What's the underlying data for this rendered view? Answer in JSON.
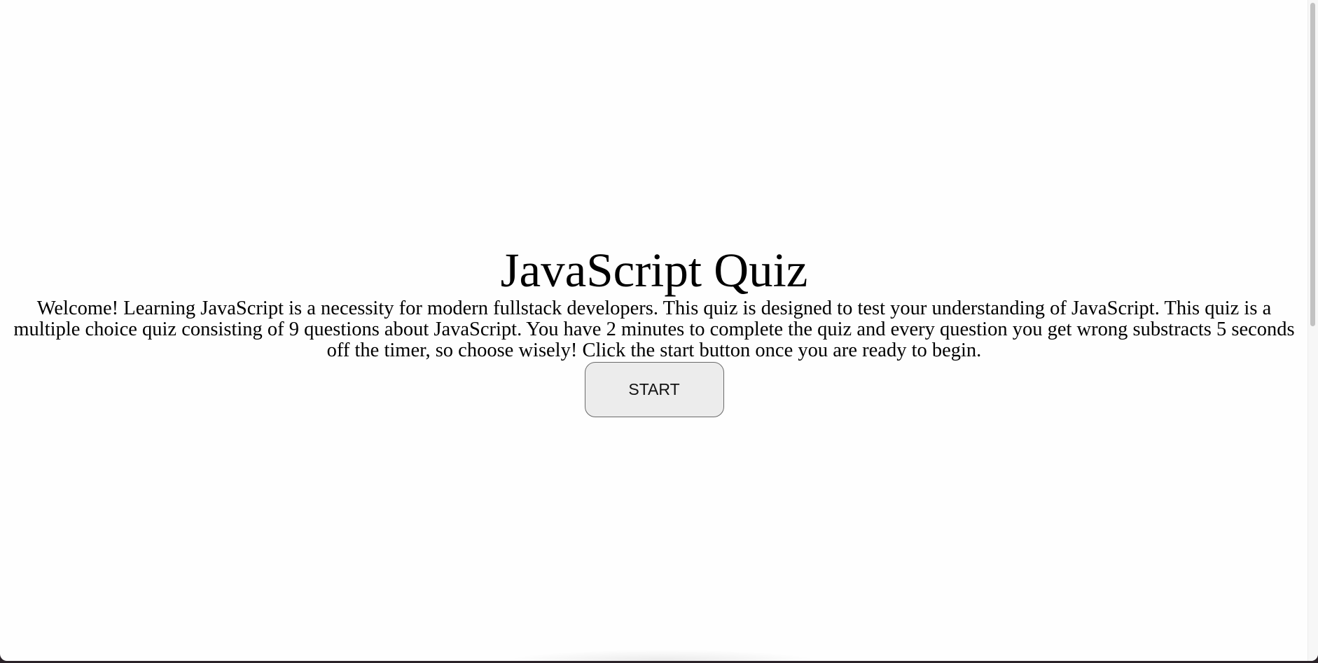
{
  "quiz": {
    "title": "JavaScript Quiz",
    "description": "Welcome! Learning JavaScript is a necessity for modern fullstack developers. This quiz is designed to test your understanding of JavaScript. This quiz is a multiple choice quiz consisting of 9 questions about JavaScript. You have 2 minutes to complete the quiz and every question you get wrong substracts 5 seconds off the timer, so choose wisely! Click the start button once you are ready to begin.",
    "start_label": "START"
  },
  "colors": {
    "page_background": "#fefefe",
    "button_background": "#ececec",
    "button_border": "#6a6a6a"
  }
}
